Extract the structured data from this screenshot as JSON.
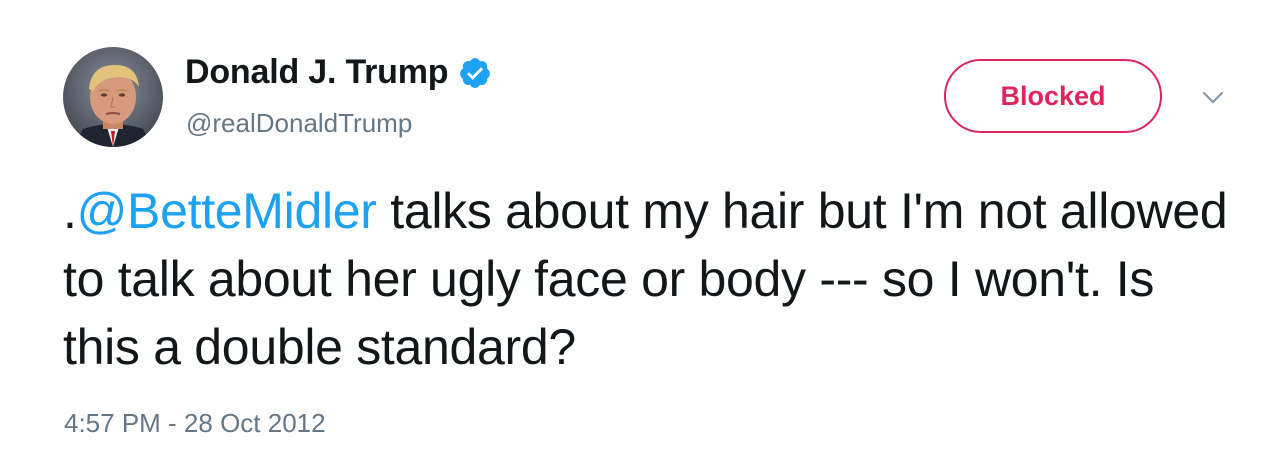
{
  "author": {
    "display_name": "Donald J. Trump",
    "handle": "@realDonaldTrump",
    "verified": true,
    "avatar_icon": "profile-photo"
  },
  "follow_button": {
    "label": "Blocked",
    "color": "#e0245e"
  },
  "menu": {
    "icon": "chevron-down-icon"
  },
  "tweet": {
    "prefix": ".",
    "mention": "@BetteMidler",
    "body": " talks about my hair but I'm not allowed to talk about her ugly face or body --- so I won't. Is this a double standard?",
    "timestamp": "4:57 PM - 28 Oct 2012"
  },
  "colors": {
    "text": "#14171a",
    "secondary": "#657786",
    "link": "#1da1f2",
    "verified": "#1da1f2"
  }
}
